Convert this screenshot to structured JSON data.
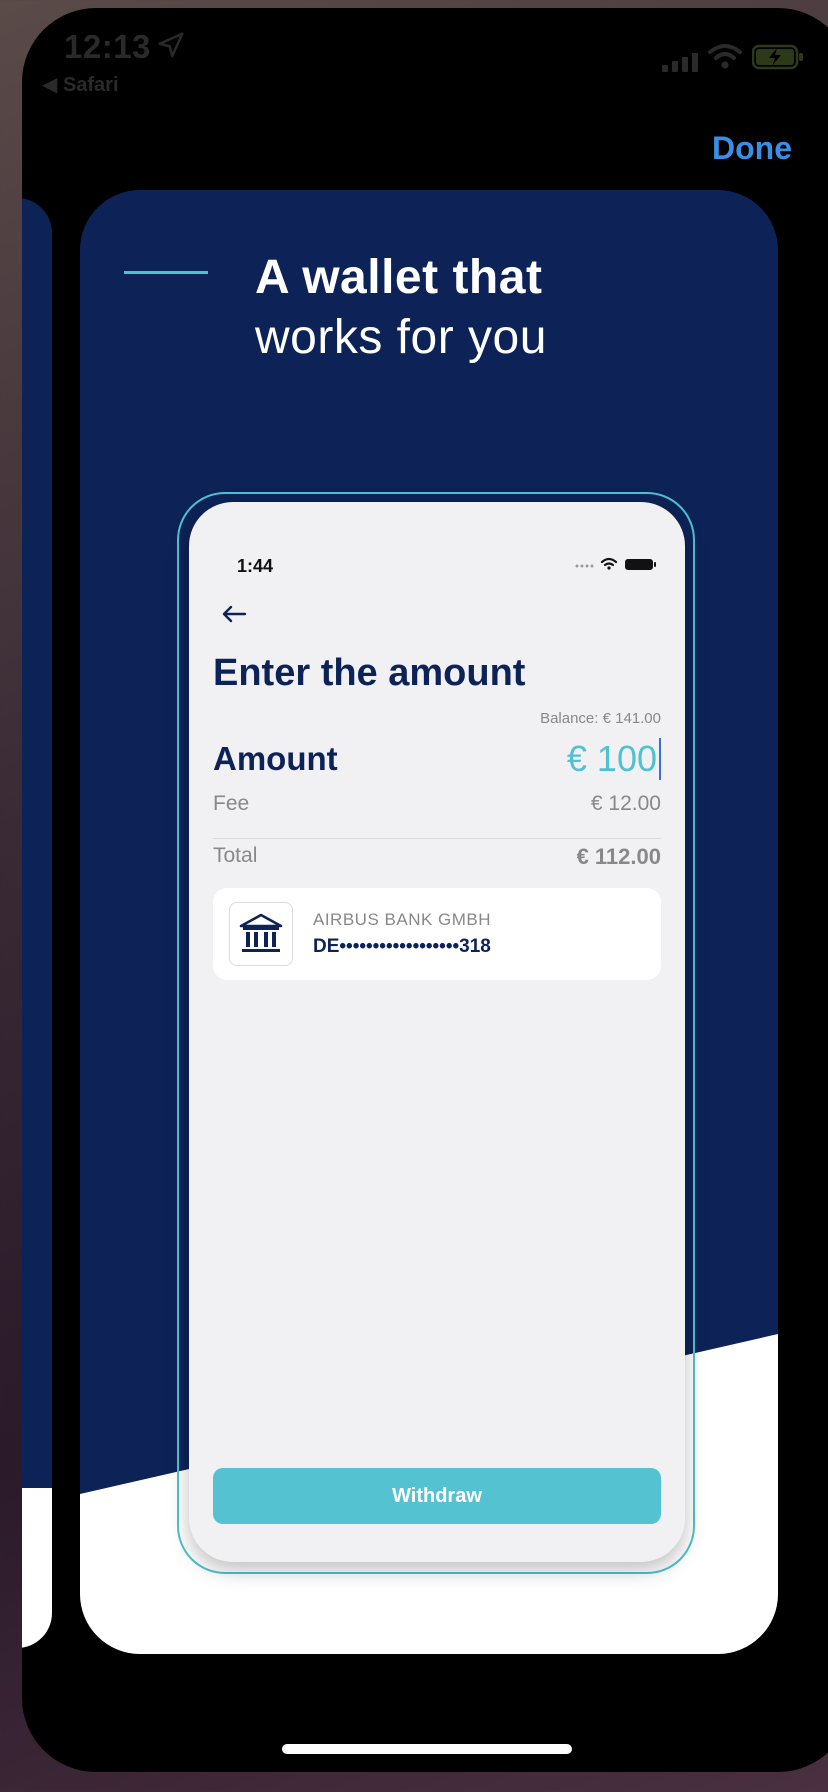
{
  "status_bar": {
    "time": "12:13",
    "back_app": "◀ Safari",
    "location_icon": "location-arrow-icon",
    "signal_icon": "signal-icon",
    "wifi_icon": "wifi-icon",
    "battery_icon": "battery-charging-icon"
  },
  "header": {
    "done_label": "Done"
  },
  "card": {
    "headline_bold": "A wallet that",
    "headline_regular": "works for you",
    "background_color": "#0d2357",
    "accent_color": "#4fc1d0"
  },
  "phone": {
    "time": "1:44",
    "back_icon": "arrow-left-icon",
    "title": "Enter the amount",
    "balance": "Balance: € 141.00",
    "amount_label": "Amount",
    "amount_value": "€ 100",
    "fee_label": "Fee",
    "fee_value": "€ 12.00",
    "total_label": "Total",
    "total_value": "€ 112.00",
    "bank": {
      "icon": "bank-icon",
      "name": "AIRBUS BANK GMBH",
      "iban": "DE••••••••••••••••••318"
    },
    "withdraw_label": "Withdraw",
    "button_color": "#55c2d1"
  }
}
